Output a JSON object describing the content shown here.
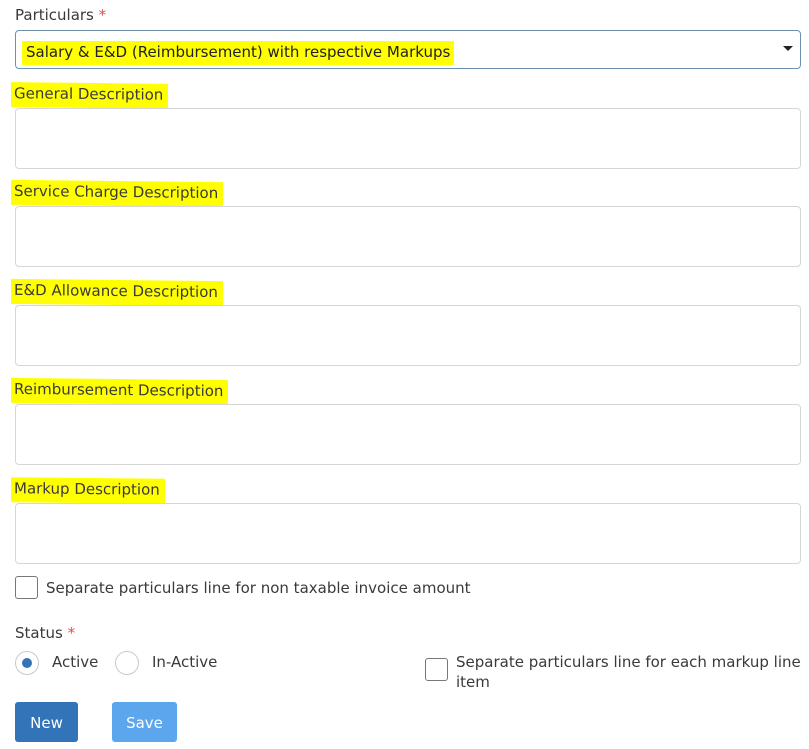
{
  "particulars": {
    "label": "Particulars",
    "required_mark": "*",
    "selected_value": "Salary & E&D (Reimbursement) with respective Markups"
  },
  "fields": {
    "general": {
      "label": "General Description",
      "value": ""
    },
    "service_charge": {
      "label": "Service Charge Description",
      "value": ""
    },
    "ed_allowance": {
      "label": "E&D Allowance Description",
      "value": ""
    },
    "reimbursement": {
      "label": "Reimbursement Description",
      "value": ""
    },
    "markup": {
      "label": "Markup Description",
      "value": ""
    }
  },
  "separate_non_taxable": {
    "label": "Separate particulars line for non taxable invoice amount",
    "checked": false
  },
  "status": {
    "label": "Status",
    "required_mark": "*",
    "options": [
      {
        "label": "Active",
        "checked": true
      },
      {
        "label": "In-Active",
        "checked": false
      }
    ]
  },
  "separate_markup_line": {
    "label": "Separate particulars line for each markup line item",
    "checked": false
  },
  "buttons": {
    "new": "New",
    "save": "Save"
  },
  "colors": {
    "highlight": "#ffff00",
    "primary_button": "#3373b7",
    "disabled_button": "#5ca6ee",
    "required": "#d9534f",
    "radio_selected": "#3373b7"
  }
}
